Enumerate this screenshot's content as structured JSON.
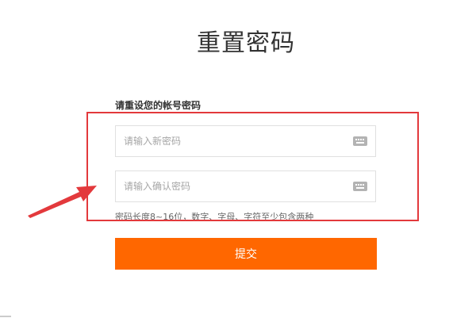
{
  "page": {
    "title": "重置密码"
  },
  "form": {
    "section_label": "请重设您的帐号密码",
    "new_password": {
      "placeholder": "请输入新密码",
      "value": "",
      "icon": "keyboard-icon"
    },
    "confirm_password": {
      "placeholder": "请输入确认密码",
      "value": "",
      "icon": "keyboard-icon"
    },
    "hint": "密码长度8~16位，数字、字母、字符至少包含两种",
    "submit_label": "提交"
  },
  "colors": {
    "accent": "#ff6700",
    "annotation": "#e3393c",
    "title_text": "#333333",
    "placeholder": "#a6a6a6",
    "border": "#e0e0e0"
  }
}
